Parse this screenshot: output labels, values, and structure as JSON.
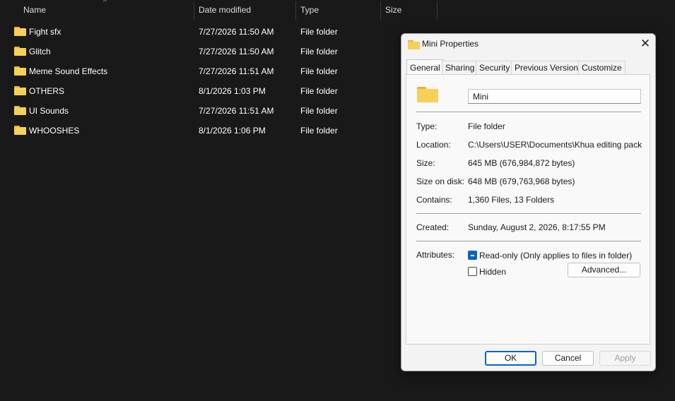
{
  "explorer": {
    "columns": {
      "name": "Name",
      "date": "Date modified",
      "type": "Type",
      "size": "Size"
    },
    "sort_arrow": "^",
    "rows": [
      {
        "name": "Fight sfx",
        "date": "7/27/2026 11:50 AM",
        "type": "File folder"
      },
      {
        "name": "Glitch",
        "date": "7/27/2026 11:50 AM",
        "type": "File folder"
      },
      {
        "name": "Meme Sound Effects",
        "date": "7/27/2026 11:51 AM",
        "type": "File folder"
      },
      {
        "name": "OTHERS",
        "date": "8/1/2026 1:03 PM",
        "type": "File folder"
      },
      {
        "name": "UI Sounds",
        "date": "7/27/2026 11:51 AM",
        "type": "File folder"
      },
      {
        "name": "WHOOSHES",
        "date": "8/1/2026 1:06 PM",
        "type": "File folder"
      }
    ]
  },
  "dialog": {
    "title": "Mini Properties",
    "close_glyph": "✕",
    "tabs": [
      "General",
      "Sharing",
      "Security",
      "Previous Versions",
      "Customize"
    ],
    "active_tab": "General",
    "folder_name": "Mini",
    "type_label": "Type:",
    "type_value": "File folder",
    "location_label": "Location:",
    "location_value": "C:\\Users\\USER\\Documents\\Khua editing pack\\sfx\\",
    "size_label": "Size:",
    "size_value": "645 MB (676,984,872 bytes)",
    "size_on_disk_label": "Size on disk:",
    "size_on_disk_value": "648 MB (679,763,968 bytes)",
    "contains_label": "Contains:",
    "contains_value": "1,360 Files, 13 Folders",
    "created_label": "Created:",
    "created_value": "Sunday, August 2, 2026, 8:17:55 PM",
    "attributes_label": "Attributes:",
    "readonly_label": "Read-only (Only applies to files in folder)",
    "readonly_state": "indeterminate",
    "hidden_label": "Hidden",
    "hidden_state": "unchecked",
    "advanced_label": "Advanced...",
    "ok_label": "OK",
    "cancel_label": "Cancel",
    "apply_label": "Apply"
  },
  "colors": {
    "accent": "#0a64c2",
    "folder": "#f8cf57",
    "background": "#191919"
  }
}
